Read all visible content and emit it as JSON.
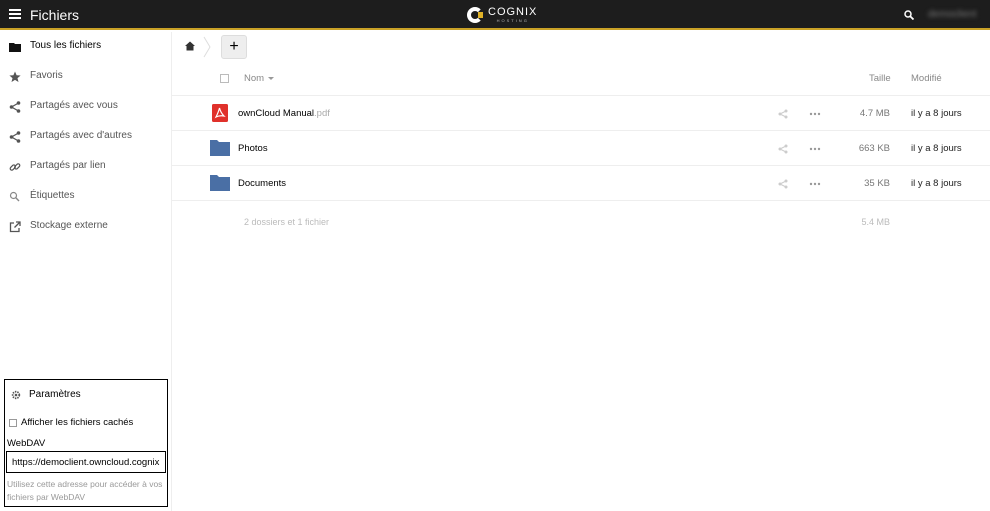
{
  "header": {
    "app_title": "Fichiers",
    "logo_text": "COGNIX",
    "logo_subtext": "HOSTING",
    "user_name": "democlient",
    "accent_color": "#c9a227"
  },
  "sidebar": {
    "items": [
      {
        "label": "Tous les fichiers",
        "icon": "folder-icon",
        "active": true
      },
      {
        "label": "Favoris",
        "icon": "star-icon"
      },
      {
        "label": "Partagés avec vous",
        "icon": "share-icon"
      },
      {
        "label": "Partagés avec d'autres",
        "icon": "share-icon"
      },
      {
        "label": "Partagés par lien",
        "icon": "link-icon"
      },
      {
        "label": "Étiquettes",
        "icon": "tag-search-icon"
      },
      {
        "label": "Stockage externe",
        "icon": "external-icon"
      }
    ],
    "settings": {
      "label": "Paramètres",
      "show_hidden_label": "Afficher les fichiers cachés",
      "webdav_label": "WebDAV",
      "webdav_value": "https://democlient.owncloud.cognix",
      "webdav_help": "Utilisez cette adresse pour accéder à vos fichiers par WebDAV"
    }
  },
  "controls": {
    "add_label": "+"
  },
  "table": {
    "col_name": "Nom",
    "col_size": "Taille",
    "col_modified": "Modifié",
    "rows": [
      {
        "name": "ownCloud Manual",
        "ext": ".pdf",
        "type": "pdf",
        "size": "4.7 MB",
        "modified": "il y a 8 jours"
      },
      {
        "name": "Photos",
        "ext": "",
        "type": "folder",
        "size": "663 KB",
        "modified": "il y a 8 jours"
      },
      {
        "name": "Documents",
        "ext": "",
        "type": "folder",
        "size": "35 KB",
        "modified": "il y a 8 jours"
      }
    ],
    "summary_text": "2 dossiers et 1 fichier",
    "summary_size": "5.4 MB"
  }
}
